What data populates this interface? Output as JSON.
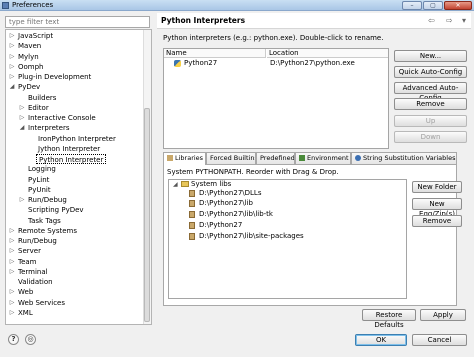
{
  "window": {
    "title": "Preferences",
    "minimize": "–",
    "maximize": "▢",
    "close": "✕"
  },
  "filter": {
    "placeholder": "type filter text"
  },
  "tree": {
    "items": [
      {
        "label": "JavaScript",
        "toggle": "▷"
      },
      {
        "label": "Maven",
        "toggle": "▷"
      },
      {
        "label": "Mylyn",
        "toggle": "▷"
      },
      {
        "label": "Oomph",
        "toggle": "▷"
      },
      {
        "label": "Plug-in Development",
        "toggle": "▷"
      },
      {
        "label": "PyDev",
        "toggle": "◢"
      },
      {
        "label": "Builders",
        "toggle": ""
      },
      {
        "label": "Editor",
        "toggle": "▷"
      },
      {
        "label": "Interactive Console",
        "toggle": "▷"
      },
      {
        "label": "Interpreters",
        "toggle": "◢"
      },
      {
        "label": "IronPython Interpreter",
        "toggle": ""
      },
      {
        "label": "Jython Interpreter",
        "toggle": ""
      },
      {
        "label": "Python Interpreter",
        "toggle": ""
      },
      {
        "label": "Logging",
        "toggle": ""
      },
      {
        "label": "PyLint",
        "toggle": ""
      },
      {
        "label": "PyUnit",
        "toggle": ""
      },
      {
        "label": "Run/Debug",
        "toggle": "▷"
      },
      {
        "label": "Scripting PyDev",
        "toggle": ""
      },
      {
        "label": "Task Tags",
        "toggle": ""
      },
      {
        "label": "Remote Systems",
        "toggle": "▷"
      },
      {
        "label": "Run/Debug",
        "toggle": "▷"
      },
      {
        "label": "Server",
        "toggle": "▷"
      },
      {
        "label": "Team",
        "toggle": "▷"
      },
      {
        "label": "Terminal",
        "toggle": "▷"
      },
      {
        "label": "Validation",
        "toggle": ""
      },
      {
        "label": "Web",
        "toggle": "▷"
      },
      {
        "label": "Web Services",
        "toggle": "▷"
      },
      {
        "label": "XML",
        "toggle": "▷"
      }
    ]
  },
  "page": {
    "title": "Python Interpreters",
    "description": "Python interpreters (e.g.: python.exe).   Double-click to rename.",
    "nav_back": "⇦",
    "nav_forward": "⇨",
    "nav_menu": "▾"
  },
  "interpreters_table": {
    "columns": [
      "Name",
      "Location"
    ],
    "rows": [
      {
        "name": "Python27",
        "location": "D:\\Python27\\python.exe"
      }
    ]
  },
  "side_buttons": {
    "new": "New...",
    "quick": "Quick Auto-Config",
    "advanced": "Advanced Auto-Config",
    "remove": "Remove",
    "up": "Up",
    "down": "Down"
  },
  "tabs": [
    "Libraries",
    "Forced Builtins",
    "Predefined",
    "Environment",
    "String Substitution Variables"
  ],
  "libraries": {
    "caption": "System PYTHONPATH.  Reorder with Drag & Drop.",
    "root": "System libs",
    "root_toggle": "◢",
    "paths": [
      "D:\\Python27\\DLLs",
      "D:\\Python27\\lib",
      "D:\\Python27\\lib\\lib-tk",
      "D:\\Python27",
      "D:\\Python27\\lib\\site-packages"
    ],
    "buttons": {
      "new_folder": "New Folder",
      "new_egg": "New Egg/Zip(s)",
      "remove": "Remove"
    }
  },
  "footer": {
    "restore": "Restore Defaults",
    "apply": "Apply",
    "ok": "OK",
    "cancel": "Cancel",
    "help_glyph": "?",
    "prefs_glyph": "◎"
  }
}
